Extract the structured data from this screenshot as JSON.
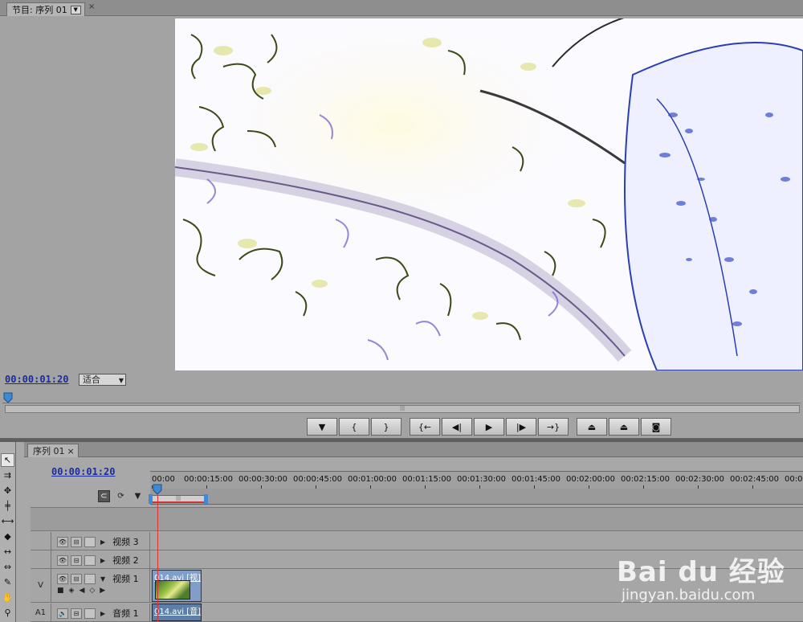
{
  "program_monitor": {
    "tab_title": "节目: 序列 01",
    "close_label": "×",
    "timecode": "00:00:01:20",
    "zoom_value": "适合",
    "transport": [
      {
        "icon": "marker-icon",
        "label": "▼"
      },
      {
        "icon": "mark-in-icon",
        "label": "{"
      },
      {
        "icon": "mark-out-icon",
        "label": "}"
      },
      {
        "icon": "go-to-in-icon",
        "label": "{←"
      },
      {
        "icon": "step-back-icon",
        "label": "◀|"
      },
      {
        "icon": "play-icon",
        "label": "▶"
      },
      {
        "icon": "step-forward-icon",
        "label": "|▶"
      },
      {
        "icon": "go-to-out-icon",
        "label": "→}"
      },
      {
        "icon": "lift-icon",
        "label": "⏏"
      },
      {
        "icon": "extract-icon",
        "label": "⏏"
      },
      {
        "icon": "export-frame-icon",
        "label": "◙"
      }
    ]
  },
  "timeline": {
    "tab_title": "序列 01",
    "close_label": "×",
    "timecode": "00:00:01:20",
    "ruler_labels": [
      "00:00",
      "00:00:15:00",
      "00:00:30:00",
      "00:00:45:00",
      "00:01:00:00",
      "00:01:15:00",
      "00:01:30:00",
      "00:01:45:00",
      "00:02:00:00",
      "00:02:15:00",
      "00:02:30:00",
      "00:02:45:00",
      "00:0"
    ],
    "tracks": [
      {
        "label": "",
        "name": "视频 3",
        "kind": "video"
      },
      {
        "label": "",
        "name": "视频 2",
        "kind": "video"
      },
      {
        "label": "V",
        "name": "视频 1",
        "kind": "video",
        "clip": "014.avi [视]"
      },
      {
        "label": "A1",
        "name": "音频 1",
        "kind": "audio",
        "clip": "014.avi [音]"
      }
    ]
  },
  "tools": [
    "selection-tool",
    "track-select-tool",
    "ripple-edit-tool",
    "rolling-edit-tool",
    "rate-stretch-tool",
    "razor-tool",
    "slip-tool",
    "slide-tool",
    "pen-tool",
    "hand-tool",
    "zoom-tool"
  ],
  "watermark": {
    "main": "Bai du 经验",
    "sub": "jingyan.baidu.com"
  }
}
